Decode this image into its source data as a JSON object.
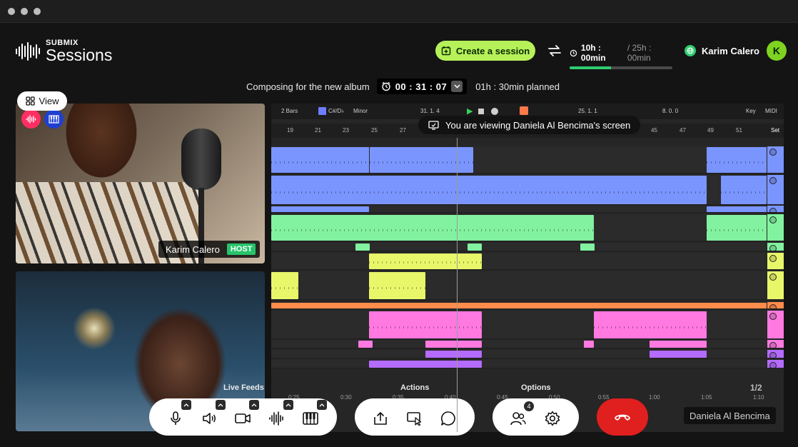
{
  "app": {
    "logo_small": "SUBMIX",
    "logo_big": "Sessions"
  },
  "header": {
    "create_session_label": "Create a session",
    "time_used": "10h : 00min",
    "time_sep": "/",
    "time_total": "25h : 00min",
    "time_progress": 0.4,
    "user_name": "Karim Calero",
    "user_initial": "K"
  },
  "session": {
    "title": "Composing for the new album",
    "clock": "00 : 31 : 07",
    "planned": "01h : 30min planned"
  },
  "view_button": {
    "label": "View"
  },
  "feeds": {
    "host_name": "Karim Calero",
    "host_badge": "HOST",
    "remote_name": "Daniela Al Bencima"
  },
  "daw": {
    "viewing_text": "You are viewing Daniela Al Bencima's screen",
    "toolbar": {
      "bars": "2 Bars",
      "key": "C#/D♭",
      "scale": "Minor",
      "position": "31.  1.  4",
      "loop_start": "25.  1.  1",
      "loop_len": "8.  0.  0",
      "key_btn": "Key",
      "midi_btn": "MIDI",
      "set_btn": "Set"
    },
    "bar_numbers": [
      "19",
      "21",
      "23",
      "25",
      "27",
      "45",
      "47",
      "49",
      "51"
    ],
    "time_marks": [
      "0:25",
      "0:30",
      "0:35",
      "0:40",
      "0:45",
      "0:50",
      "0:55",
      "1:00",
      "1:05",
      "1:10"
    ]
  },
  "sections": {
    "live_feeds": "Live Feeds",
    "actions": "Actions",
    "options": "Options",
    "page": "1/2"
  },
  "controls": {
    "participants_count": "4"
  },
  "colors": {
    "accent_green": "#b6f15a",
    "hangup_red": "#e01f1f",
    "host_badge": "#27c46a",
    "clip_blue": "#7b95ff",
    "clip_green": "#82f2a0",
    "clip_yellow": "#e8f76a",
    "clip_orange": "#ff8c4a",
    "clip_pink": "#ff79e0",
    "clip_purple": "#b46bff"
  }
}
